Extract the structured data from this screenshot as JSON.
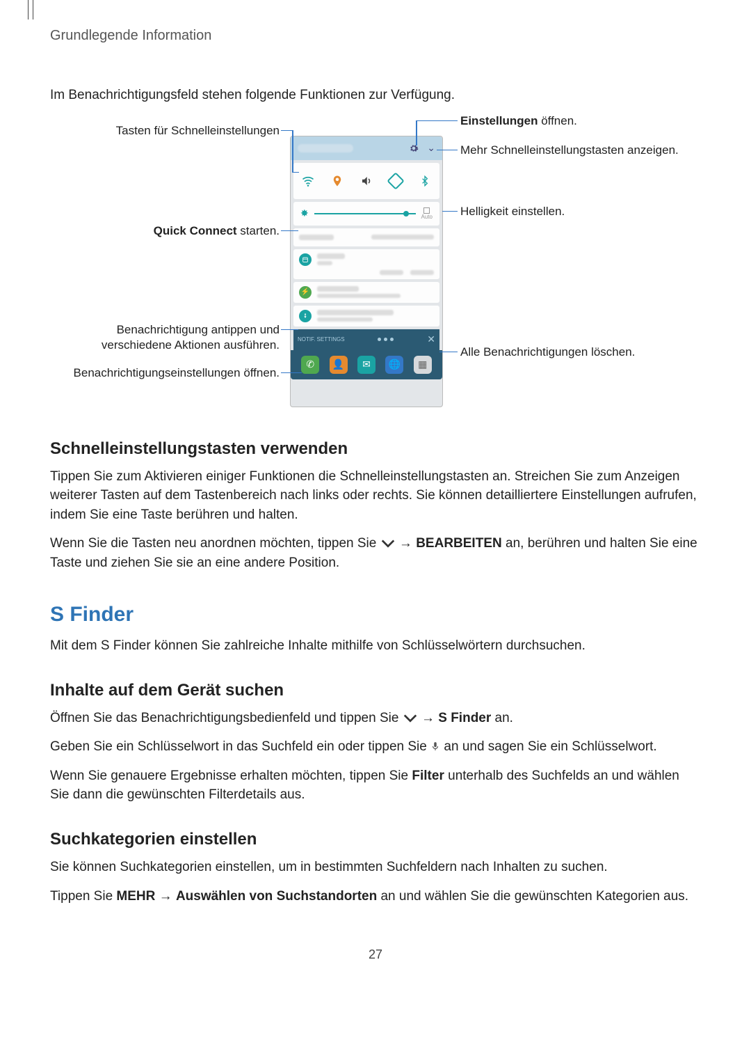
{
  "breadcrumb": "Grundlegende Information",
  "intro": "Im Benachrichtigungsfeld stehen folgende Funktionen zur Verfügung.",
  "callouts": {
    "left1": "Tasten für Schnelleinstellungen",
    "left2_a": "Quick Connect",
    "left2_b": " starten.",
    "left3": "Benachrichtigung antippen und verschiedene Aktionen ausführen.",
    "left4": "Benachrichtigungseinstellungen öffnen.",
    "right1_a": "Einstellungen",
    "right1_b": " öffnen.",
    "right2": "Mehr Schnelleinstellungstasten anzeigen.",
    "right3": "Helligkeit einstellen.",
    "right4": "Alle Benachrichtigungen löschen."
  },
  "phone": {
    "auto": "Auto"
  },
  "section1_title": "Schnelleinstellungstasten verwenden",
  "section1_p1": "Tippen Sie zum Aktivieren einiger Funktionen die Schnelleinstellungstasten an. Streichen Sie zum Anzeigen weiterer Tasten auf dem Tastenbereich nach links oder rechts. Sie können detailliertere Einstellungen aufrufen, indem Sie eine Taste berühren und halten.",
  "section1_p2_a": "Wenn Sie die Tasten neu anordnen möchten, tippen Sie ",
  "section1_p2_b": " → ",
  "section1_p2_c": "BEARBEITEN",
  "section1_p2_d": " an, berühren und halten Sie eine Taste und ziehen Sie sie an eine andere Position.",
  "h1_sfinder": "S Finder",
  "sfinder_intro": "Mit dem S Finder können Sie zahlreiche Inhalte mithilfe von Schlüsselwörtern durchsuchen.",
  "section2_title": "Inhalte auf dem Gerät suchen",
  "section2_p1_a": "Öffnen Sie das Benachrichtigungsbedienfeld und tippen Sie ",
  "section2_p1_b": " → ",
  "section2_p1_c": "S Finder",
  "section2_p1_d": " an.",
  "section2_p2_a": "Geben Sie ein Schlüsselwort in das Suchfeld ein oder tippen Sie ",
  "section2_p2_b": " an und sagen Sie ein Schlüsselwort.",
  "section2_p3_a": "Wenn Sie genauere Ergebnisse erhalten möchten, tippen Sie ",
  "section2_p3_b": "Filter",
  "section2_p3_c": " unterhalb des Suchfelds an und wählen Sie dann die gewünschten Filterdetails aus.",
  "section3_title": "Suchkategorien einstellen",
  "section3_p1": "Sie können Suchkategorien einstellen, um in bestimmten Suchfeldern nach Inhalten zu suchen.",
  "section3_p2_a": "Tippen Sie ",
  "section3_p2_b": "MEHR",
  "section3_p2_c": " → ",
  "section3_p2_d": "Auswählen von Suchstandorten",
  "section3_p2_e": " an und wählen Sie die gewünschten Kategorien aus.",
  "page_number": "27"
}
